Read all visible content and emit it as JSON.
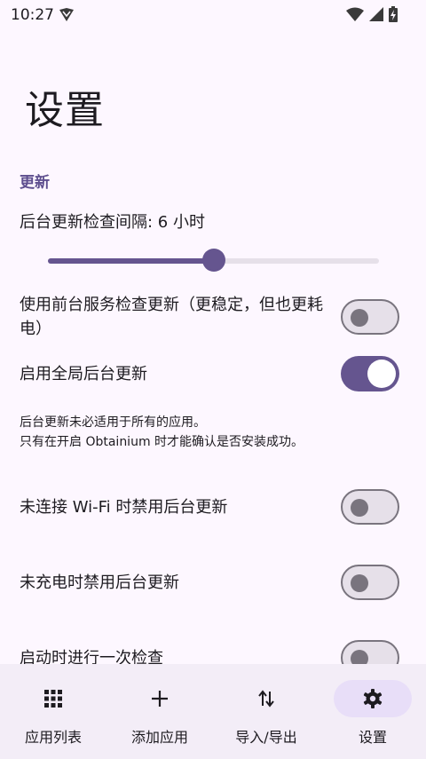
{
  "status_bar": {
    "time": "10:27"
  },
  "page": {
    "title": "设置"
  },
  "updates_section": {
    "header": "更新",
    "interval_label": "后台更新检查间隔: 6 小时",
    "interval_slider_fraction": 0.5,
    "foreground_service": {
      "label": "使用前台服务检查更新（更稳定，但也更耗电）",
      "enabled": false
    },
    "global_background": {
      "label": "启用全局后台更新",
      "enabled": true
    },
    "note_line1": "后台更新未必适用于所有的应用。",
    "note_line2": "只有在开启 Obtainium 时才能确认是否安装成功。",
    "disable_without_wifi": {
      "label": "未连接 Wi-Fi 时禁用后台更新",
      "enabled": false
    },
    "disable_not_charging": {
      "label": "未充电时禁用后台更新",
      "enabled": false
    },
    "check_on_start": {
      "label": "启动时进行一次检查",
      "enabled": false
    }
  },
  "bottom_nav": {
    "items": [
      {
        "label": "应用列表",
        "icon": "grid-icon",
        "active": false
      },
      {
        "label": "添加应用",
        "icon": "plus-icon",
        "active": false
      },
      {
        "label": "导入/导出",
        "icon": "import-export-icon",
        "active": false
      },
      {
        "label": "设置",
        "icon": "gear-icon",
        "active": true
      }
    ]
  },
  "colors": {
    "background": "#fdf7ff",
    "accent": "#65558f",
    "section_header": "#5e4f8f",
    "nav_background": "#f3edf7",
    "nav_active_pill": "#e8def8"
  }
}
